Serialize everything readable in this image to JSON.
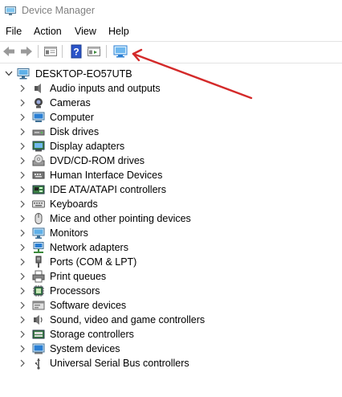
{
  "window": {
    "title": "Device Manager",
    "title_color": "#808080"
  },
  "menu": {
    "items": [
      "File",
      "Action",
      "View",
      "Help"
    ]
  },
  "toolbar": {
    "buttons": [
      "back-arrow-icon",
      "forward-arrow-icon",
      "properties-icon",
      "help-icon",
      "show-hide-console-tree-icon",
      "scan-hardware-changes-icon"
    ]
  },
  "tree": {
    "root": "DESKTOP-EO57UTB",
    "categories": [
      "Audio inputs and outputs",
      "Cameras",
      "Computer",
      "Disk drives",
      "Display adapters",
      "DVD/CD-ROM drives",
      "Human Interface Devices",
      "IDE ATA/ATAPI controllers",
      "Keyboards",
      "Mice and other pointing devices",
      "Monitors",
      "Network adapters",
      "Ports (COM & LPT)",
      "Print queues",
      "Processors",
      "Software devices",
      "Sound, video and game controllers",
      "Storage controllers",
      "System devices",
      "Universal Serial Bus controllers"
    ]
  },
  "colors": {
    "annotation_arrow": "#d42a2a",
    "accent_blue": "#2a7fd4"
  }
}
